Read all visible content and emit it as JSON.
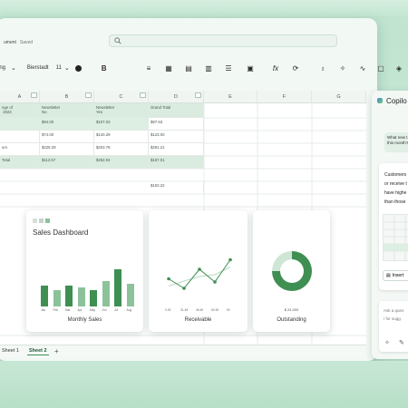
{
  "window": {
    "doc_name": "ument",
    "status": "Saved"
  },
  "ribbon": {
    "style": "ing",
    "font": "Bierstadt",
    "size": "11",
    "bold": "B",
    "fx": "fx"
  },
  "columns": [
    "A",
    "B",
    "C",
    "D",
    "E",
    "F",
    "G"
  ],
  "table": {
    "headers": [
      "nge of\n 2022",
      "Newsletter\nNo",
      "Newsletter\nYes",
      "Grand Total"
    ],
    "rows": [
      [
        "",
        "$94.00",
        "$107.03",
        "$97.63"
      ],
      [
        "",
        "$74.00",
        "$140.29",
        "$123.00"
      ],
      [
        "um",
        "$228.29",
        "$203.78",
        "$281.21"
      ],
      [
        "Total",
        "$112.57",
        "$262.04",
        "$157.01"
      ]
    ],
    "extra": "$153.22"
  },
  "dashboard": {
    "title": "Sales Dashboard",
    "monthly_label": "Monthly Sales",
    "months": [
      "Jan",
      "Feb",
      "Mar",
      "Apr",
      "May",
      "Jun",
      "Jul",
      "Aug"
    ],
    "receivable_label": "Receivable",
    "receivable_ticks": [
      "0-30",
      "31-45",
      "46-60",
      "60-90",
      "90"
    ],
    "outstanding_label": "Outstanding",
    "outstanding_value": "$ 24,000"
  },
  "chart_data": [
    {
      "type": "bar",
      "title": "Sales Dashboard",
      "xlabel": "Monthly Sales",
      "categories": [
        "Jan",
        "Feb",
        "Mar",
        "Apr",
        "May",
        "Jun",
        "Jul",
        "Aug"
      ],
      "values": [
        50,
        40,
        50,
        45,
        40,
        60,
        90,
        55
      ]
    },
    {
      "type": "line",
      "xlabel": "Receivable",
      "x": [
        "0-30",
        "31-45",
        "46-60",
        "60-90",
        "90"
      ],
      "values": [
        35,
        20,
        50,
        30,
        65
      ]
    },
    {
      "type": "pie",
      "xlabel": "Outstanding",
      "values": [
        75,
        25
      ]
    }
  ],
  "tabs": {
    "sheet1": "Sheet 1",
    "sheet2": "Sheet 2",
    "add": "+"
  },
  "copilot": {
    "title": "Copilo",
    "msg1": "What new t\nthis month's",
    "msg2": "Customers\nor receive t\nhave highe\nthan those",
    "insert": "Insert",
    "ask": "Ask a ques\n/ for sugg"
  },
  "colors": {
    "accent": "#3f8f52",
    "light": "#8cc29a"
  }
}
